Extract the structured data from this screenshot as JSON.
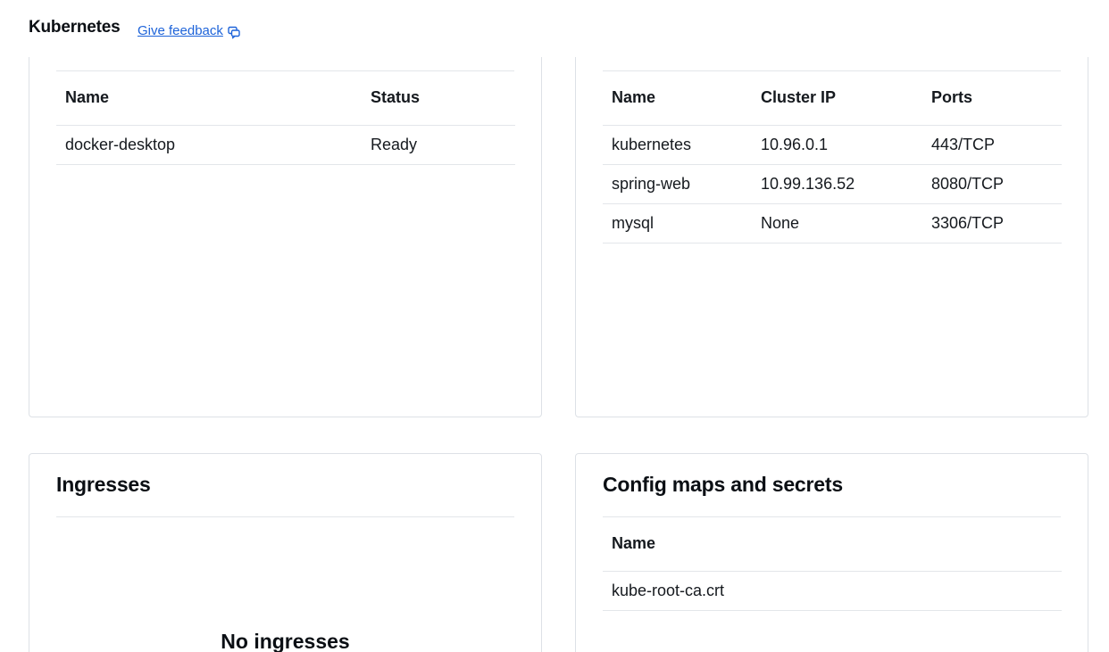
{
  "header": {
    "title": "Kubernetes",
    "feedback_label": "Give feedback",
    "feedback_icon": "feedback-icon"
  },
  "nodes_card": {
    "columns": [
      "Name",
      "Status"
    ],
    "rows": [
      {
        "name": "docker-desktop",
        "status": "Ready"
      }
    ]
  },
  "services_card": {
    "columns": [
      "Name",
      "Cluster IP",
      "Ports"
    ],
    "rows": [
      {
        "name": "kubernetes",
        "cluster_ip": "10.96.0.1",
        "ports": "443/TCP"
      },
      {
        "name": "spring-web",
        "cluster_ip": "10.99.136.52",
        "ports": "8080/TCP"
      },
      {
        "name": "mysql",
        "cluster_ip": "None",
        "ports": "3306/TCP"
      }
    ]
  },
  "ingresses_card": {
    "title": "Ingresses",
    "empty_title": "No ingresses"
  },
  "configmaps_card": {
    "title": "Config maps and secrets",
    "columns": [
      "Name"
    ],
    "rows": [
      {
        "name": "kube-root-ca.crt"
      }
    ]
  },
  "colors": {
    "link": "#1d63d9",
    "border": "#dde1e6",
    "text": "#101418"
  }
}
